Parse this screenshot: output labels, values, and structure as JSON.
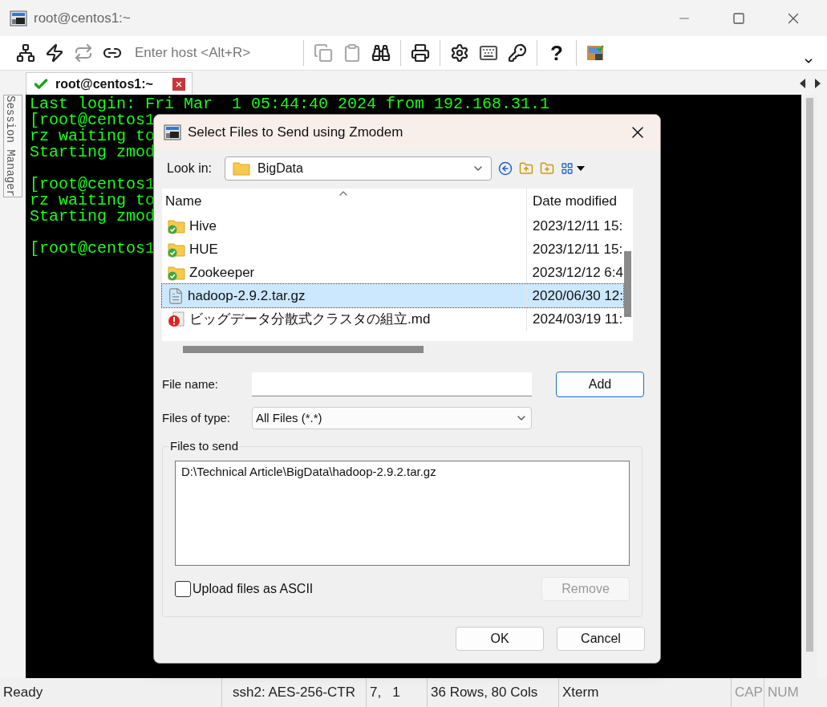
{
  "window": {
    "title": "root@centos1:~"
  },
  "toolbar": {
    "host_placeholder": "Enter host <Alt+R>",
    "help": "?"
  },
  "tabs": [
    {
      "label": "root@centos1:~",
      "selected": true
    }
  ],
  "session_manager": {
    "label": "Session Manager"
  },
  "terminal": {
    "blocks": [
      [
        "Last login: Fri Mar  1 05:44:40 2024 from 192.168.31.1",
        "[root@centos1",
        "rz waiting to",
        "Starting zmod"
      ],
      [
        "[root@centos1",
        "rz waiting to",
        "Starting zmod"
      ],
      [
        "[root@centos1"
      ]
    ]
  },
  "dialog": {
    "title": "Select Files to Send using Zmodem",
    "look_in": {
      "label": "Look in:",
      "value": "BigData"
    },
    "columns": [
      "Name",
      "Date modified"
    ],
    "files": [
      {
        "name": "Hive",
        "date": "2023/12/11 15:",
        "kind": "folder",
        "selected": false
      },
      {
        "name": "HUE",
        "date": "2023/12/11 15:",
        "kind": "folder",
        "selected": false
      },
      {
        "name": "Zookeeper",
        "date": "2023/12/12 6:4",
        "kind": "folder",
        "selected": false
      },
      {
        "name": "hadoop-2.9.2.tar.gz",
        "date": "2020/06/30 12:",
        "kind": "file",
        "selected": true
      },
      {
        "name": "ビッグデータ分散式クラスタの組立.md",
        "date": "2024/03/19 11:",
        "kind": "warning",
        "selected": false
      }
    ],
    "file_name": {
      "label": "File name:"
    },
    "add_button": "Add",
    "file_type": {
      "label": "Files of type:",
      "value": "All Files (*.*)"
    },
    "files_to_send": {
      "label": "Files to send",
      "items": [
        "D:\\Technical Article\\BigData\\hadoop-2.9.2.tar.gz"
      ]
    },
    "ascii_checkbox": {
      "label": "Upload files as ASCII",
      "checked": false
    },
    "remove_button": {
      "label": "Remove",
      "disabled": true
    },
    "ok_button": "OK",
    "cancel_button": "Cancel"
  },
  "status_bar": [
    "Ready",
    "ssh2: AES-256-CTR",
    "7,   1",
    "36 Rows, 80 Cols",
    "Xterm",
    "CAP",
    "NUM"
  ]
}
